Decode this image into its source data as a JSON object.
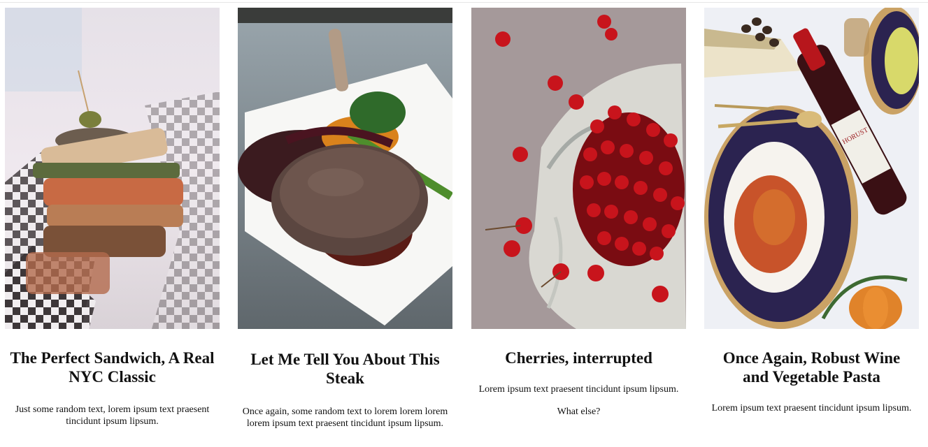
{
  "cards": [
    {
      "title": "The Perfect Sandwich, A Real NYC Classic",
      "paragraphs": [
        "Just some random text, lorem ipsum text praesent tincidunt ipsum lipsum."
      ],
      "image": "sandwich-photo"
    },
    {
      "title": "Let Me Tell You About This Steak",
      "paragraphs": [
        "Once again, some random text to lorem lorem lorem lorem ipsum text praesent tincidunt ipsum lipsum."
      ],
      "image": "steak-photo"
    },
    {
      "title": "Cherries, interrupted",
      "paragraphs": [
        "Lorem ipsum text praesent tincidunt ipsum lipsum.",
        "What else?"
      ],
      "image": "cherries-photo"
    },
    {
      "title": "Once Again, Robust Wine and Vegetable Pasta",
      "paragraphs": [
        "Lorem ipsum text praesent tincidunt ipsum lipsum."
      ],
      "image": "wine-pasta-photo"
    }
  ],
  "wine_label": "HORUST"
}
